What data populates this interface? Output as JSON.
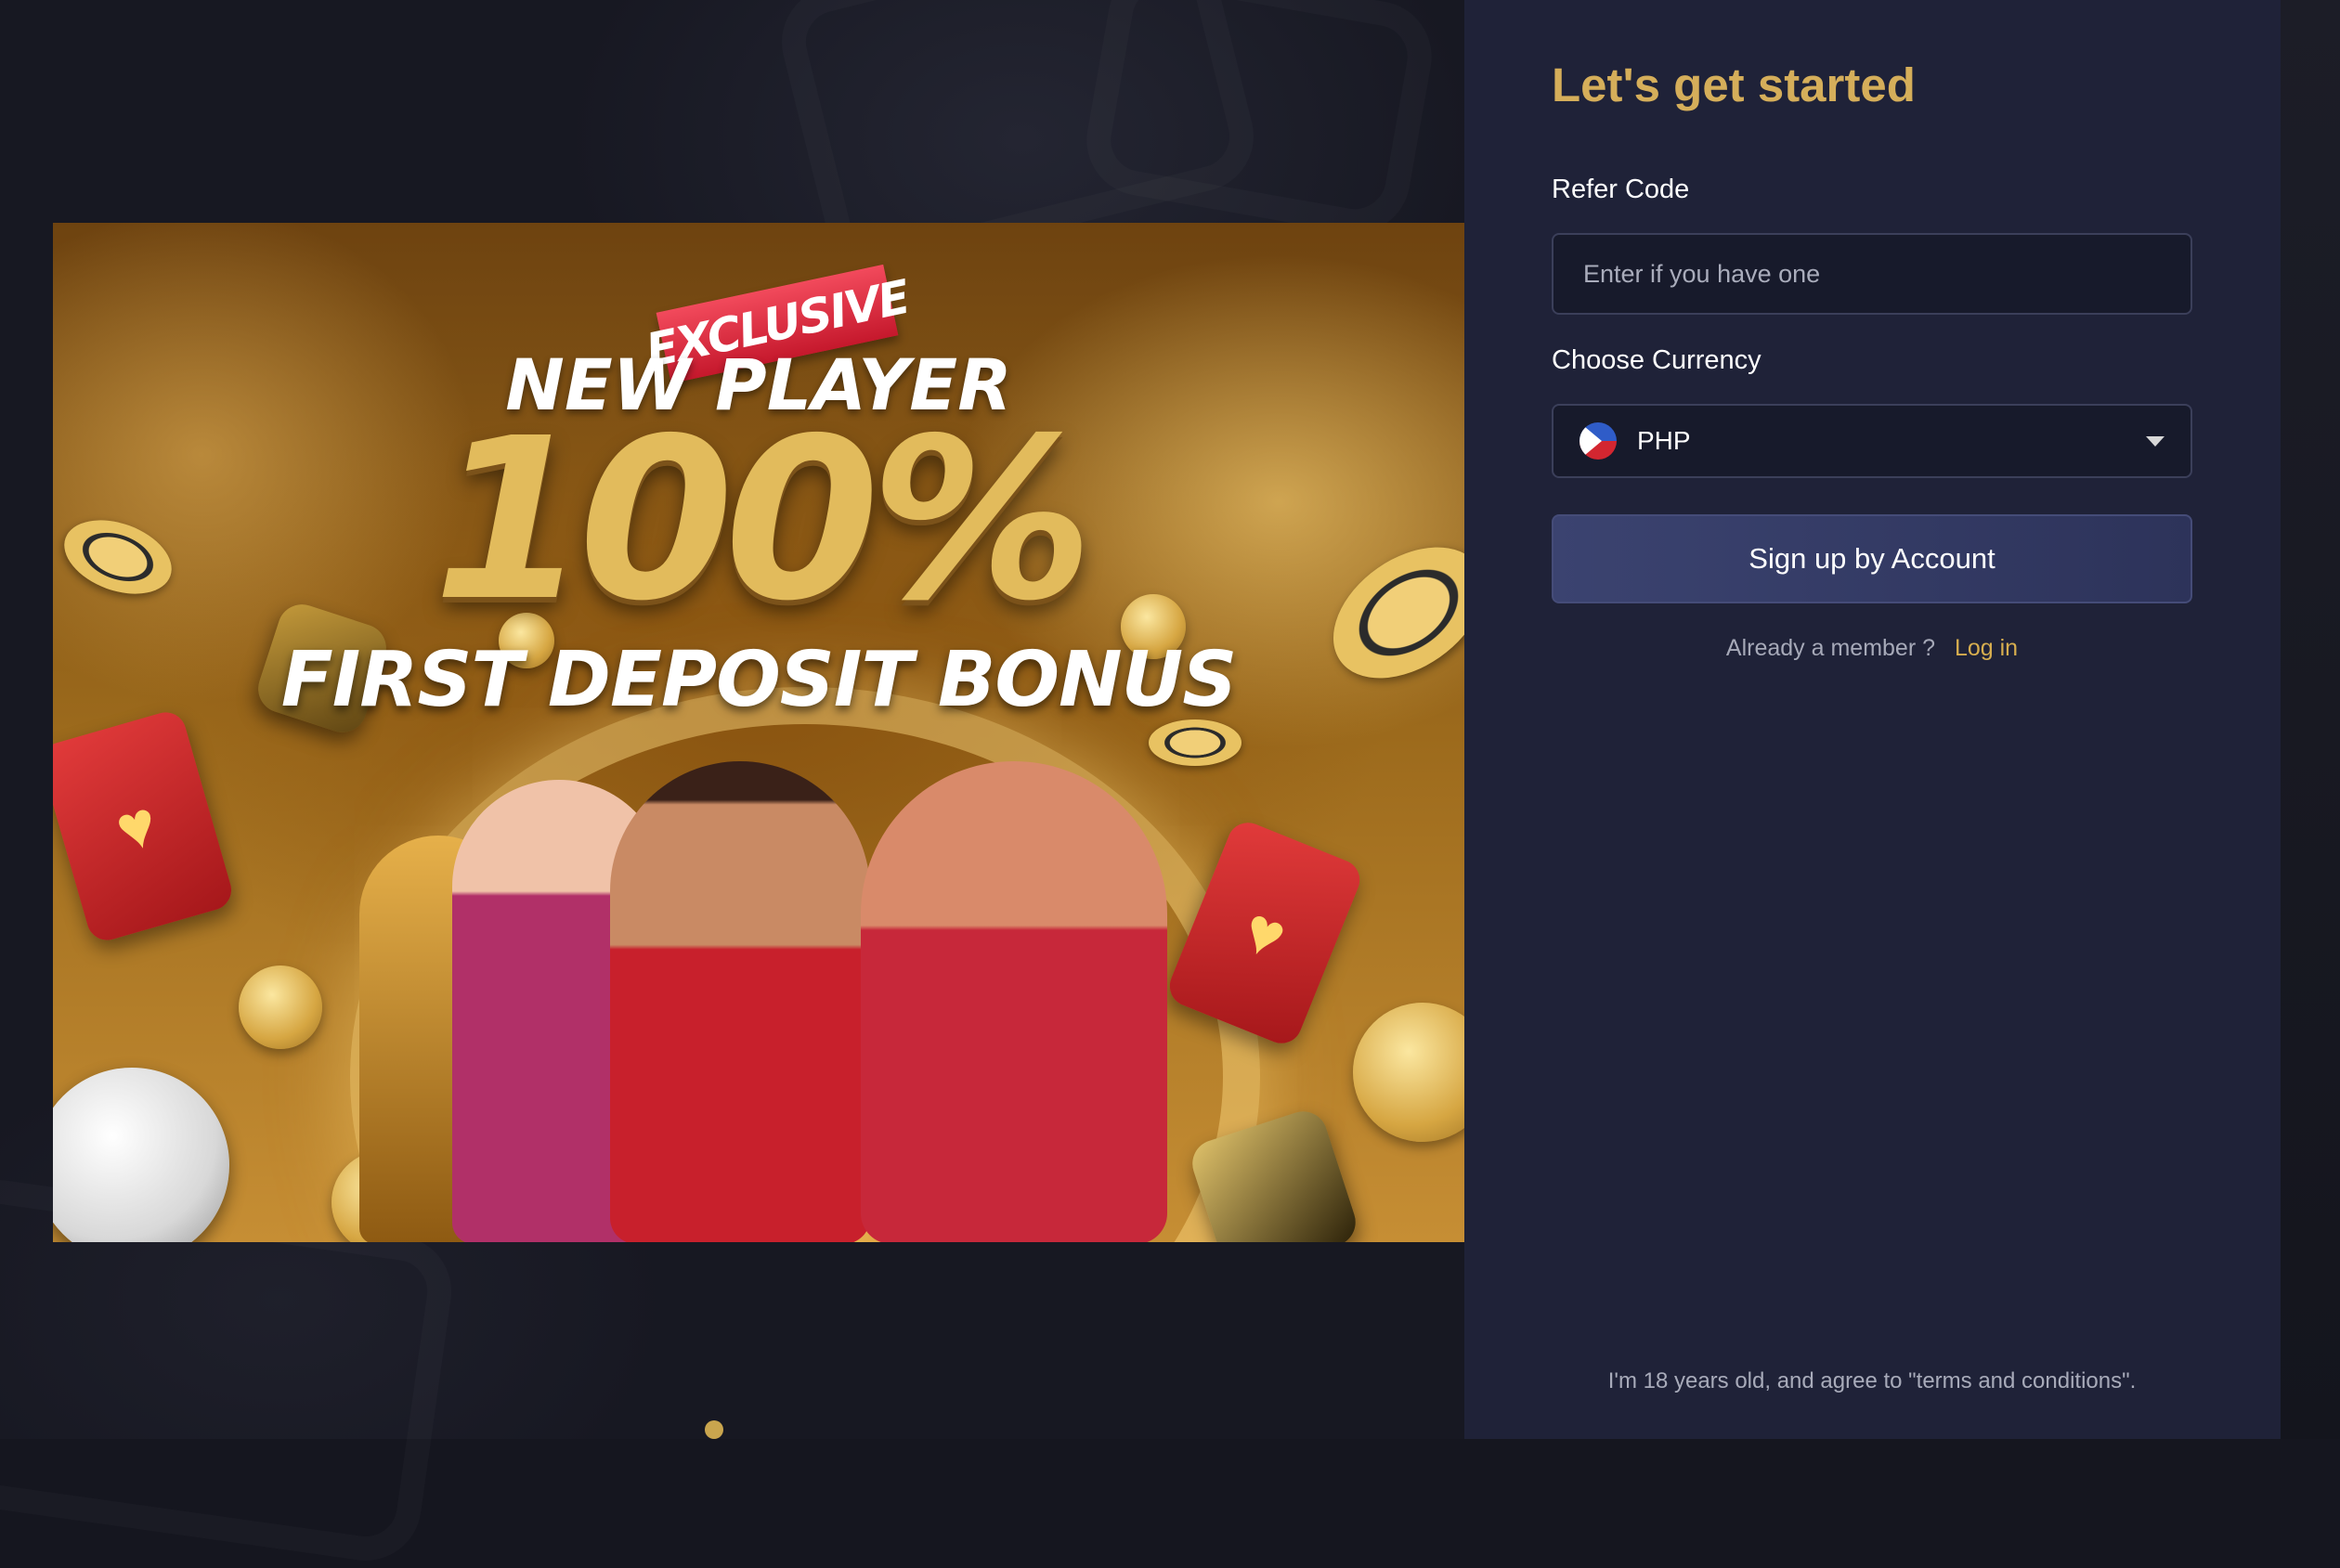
{
  "banner": {
    "ribbon": "EXCLUSIVE",
    "line1": "NEW PLAYER",
    "line2": "100%",
    "line3": "FIRST DEPOSIT BONUS"
  },
  "form": {
    "title": "Let's get started",
    "refer_label": "Refer Code",
    "refer_placeholder": "Enter if you have one",
    "currency_label": "Choose Currency",
    "currency_value": "PHP",
    "signup_label": "Sign up by Account",
    "member_text": "Already a member ?",
    "login_label": "Log in",
    "terms": "I'm 18 years old, and agree to \"terms and conditions\"."
  },
  "icons": {
    "flag": "philippines-flag-icon",
    "caret": "chevron-down-icon"
  },
  "colors": {
    "accent_gold": "#d5ae5a",
    "panel_bg": "#1f2238",
    "button_bg": "#3b4370"
  }
}
